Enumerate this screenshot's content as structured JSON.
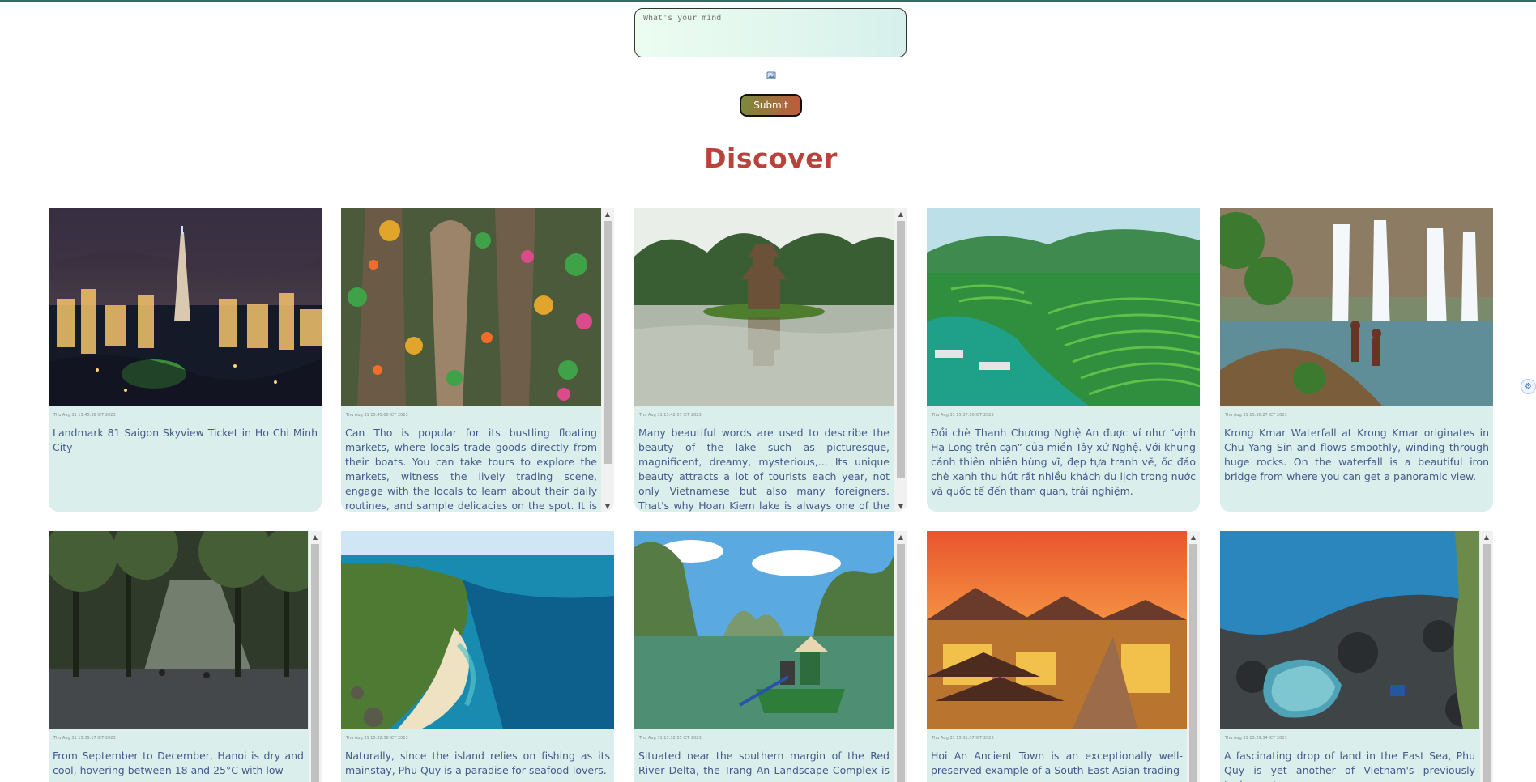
{
  "composer": {
    "placeholder": "What's your mind",
    "submit_label": "Submit"
  },
  "section": {
    "title": "Discover"
  },
  "posts": [
    {
      "date": "Thu Aug 31 15:45:38 ICT 2023",
      "text": "Landmark 81 Saigon Skyview Ticket in Ho Chi Minh City",
      "image": "landmark-81-night-skyline"
    },
    {
      "date": "Thu Aug 31 15:45:00 ICT 2023",
      "text": "Can Tho is popular for its bustling floating markets, where locals trade goods directly from their boats. You can take tours to explore the markets, witness the lively trading scene, engage with the locals to learn about their daily routines, and sample delicacies on the spot. It is an authentic Mekong",
      "image": "floating-market-boats"
    },
    {
      "date": "Thu Aug 31 15:42:57 ICT 2023",
      "text": "Many beautiful words are used to describe the beauty of the lake such as picturesque, magnificent, dreamy, mysterious,... Its unique beauty attracts a lot of tourists each year, not only Vietnamese but also many foreigners. That's why Hoan Kiem lake is always one of the top choices",
      "image": "hoan-kiem-lake-turtle-tower"
    },
    {
      "date": "Thu Aug 31 15:37:10 ICT 2023",
      "text": "Đồi chè Thanh Chương Nghệ An được ví như “vịnh Hạ Long trên cạn” của miền Tây xứ Nghệ. Với khung cảnh thiên nhiên hùng vĩ, đẹp tựa tranh vẽ, ốc đảo chè xanh thu hút rất nhiều khách du lịch trong nước và quốc tế đến tham quan, trải nghiệm.",
      "image": "tea-hills-island"
    },
    {
      "date": "Thu Aug 31 15:36:27 ICT 2023",
      "text": "Krong Kmar Waterfall at Krong Kmar originates in Chu Yang Sin and flows smoothly, winding through huge rocks. On the waterfall is a beautiful iron bridge from where you can get a panoramic view.",
      "image": "waterfall-two-women"
    },
    {
      "date": "Thu Aug 31 15:35:17 ICT 2023",
      "text": "From September to December, Hanoi is dry and cool, hovering between 18 and 25°C with low",
      "image": "hanoi-tree-street-sunbeams"
    },
    {
      "date": "Thu Aug 31 15:32:58 ICT 2023",
      "text": "Naturally, since the island relies on fishing as its mainstay, Phu Quy is a paradise for seafood-lovers.",
      "image": "island-beach-coast"
    },
    {
      "date": "Thu Aug 31 15:32:55 ICT 2023",
      "text": "Situated near the southern margin of the Red River Delta, the Trang An Landscape Complex is a",
      "image": "trang-an-boat-river"
    },
    {
      "date": "Thu Aug 31 15:31:37 ICT 2023",
      "text": "Hoi An Ancient Town is an exceptionally well-preserved example of a South-East Asian trading",
      "image": "hoi-an-old-town-sunset"
    },
    {
      "date": "Thu Aug 31 15:29:34 ICT 2023",
      "text": "A fascinating drop of land in the East Sea, Phu Quy is yet another of Vietnam's previously 'unknown'",
      "image": "phu-quy-rocky-coast"
    }
  ],
  "icons": {
    "attach": "image-icon",
    "side": "accessibility-icon"
  },
  "colors": {
    "heading": "#b9433a",
    "card_bg": "#daefec",
    "card_text": "#445a8a",
    "top_line": "#2f6f66"
  }
}
